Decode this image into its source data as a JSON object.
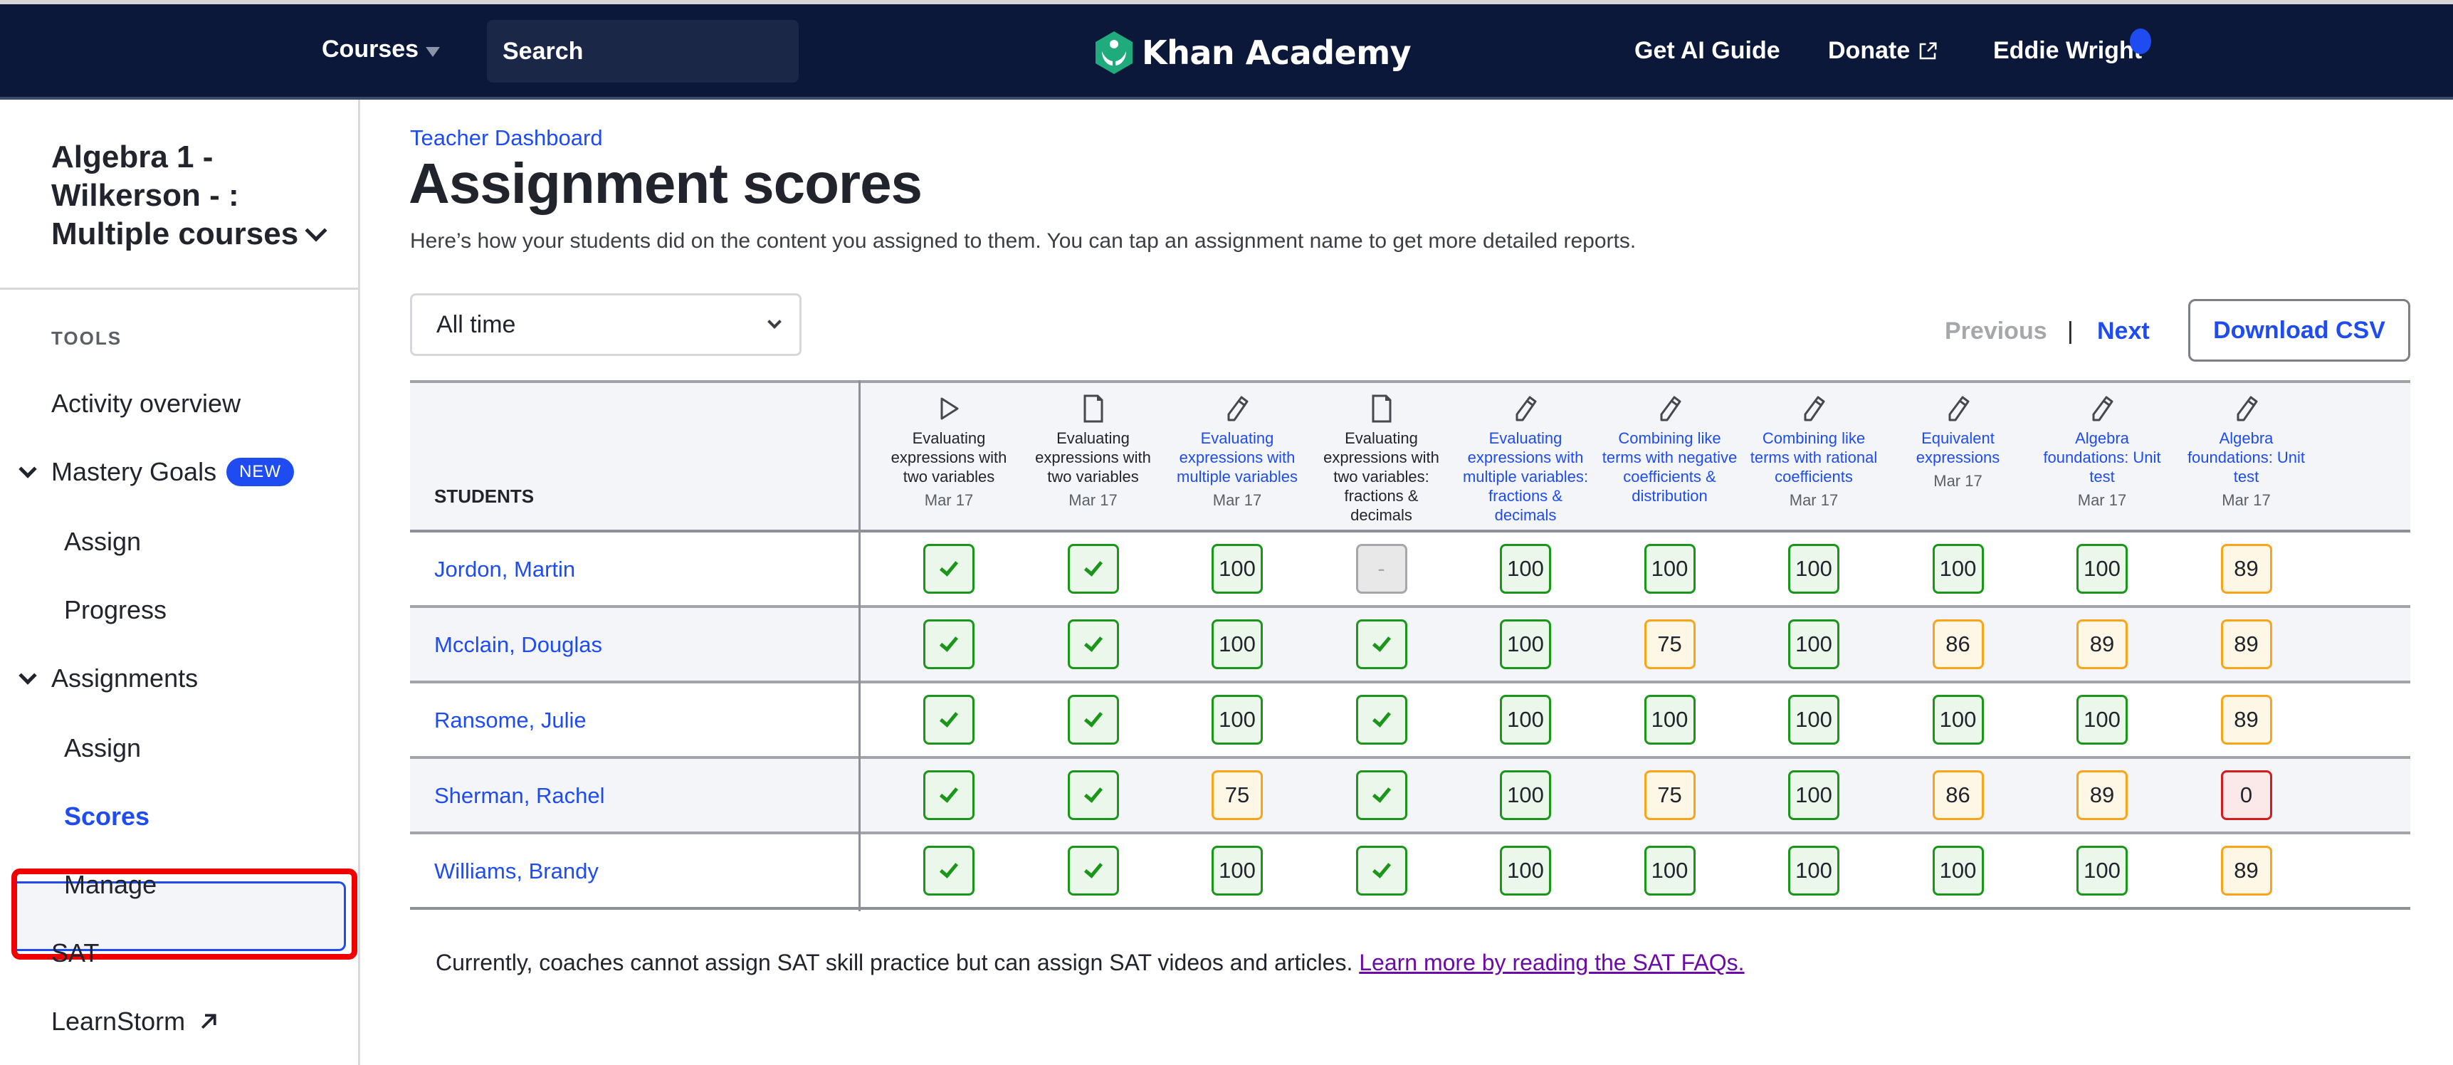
{
  "nav": {
    "courses_label": "Courses",
    "search_placeholder": "Search",
    "logo_text": "Khan Academy",
    "ai_guide_label": "Get AI Guide",
    "donate_label": "Donate",
    "user_name": "Eddie Wright"
  },
  "sidebar": {
    "course_title": "Algebra 1 - Wilkerson - : Multiple courses",
    "tools_label": "TOOLS",
    "activity_overview": "Activity overview",
    "mastery_goals": "Mastery Goals",
    "new_badge": "NEW",
    "mastery_assign": "Assign",
    "mastery_progress": "Progress",
    "assignments": "Assignments",
    "assignments_assign": "Assign",
    "assignments_scores": "Scores",
    "assignments_manage": "Manage",
    "sat": "SAT",
    "learnstorm": "LearnStorm"
  },
  "main": {
    "breadcrumb": "Teacher Dashboard",
    "title": "Assignment scores",
    "subtitle": "Here’s how your students did on the content you assigned to them. You can tap an assignment name to get more detailed reports.",
    "timeframe": "All time",
    "previous_label": "Previous",
    "separator": "|",
    "next_label": "Next",
    "download_csv": "Download CSV",
    "footnote_text": "Currently, coaches cannot assign SAT skill practice but can assign SAT videos and articles. ",
    "footnote_link": "Learn more by reading the SAT FAQs."
  },
  "table": {
    "students_header": "STUDENTS",
    "columns": [
      {
        "icon": "video-play-icon",
        "title": "Evaluating expressions with two variables",
        "date": "Mar 17",
        "link": false
      },
      {
        "icon": "article-icon",
        "title": "Evaluating expressions with two variables",
        "date": "Mar 17",
        "link": false
      },
      {
        "icon": "pencil-icon",
        "title": "Evaluating expressions with multiple variables",
        "date": "Mar 17",
        "link": true
      },
      {
        "icon": "article-icon",
        "title": "Evaluating expressions with two variables: fractions & decimals",
        "date": "",
        "link": false
      },
      {
        "icon": "pencil-icon",
        "title": "Evaluating expressions with multiple variables: fractions & decimals",
        "date": "",
        "link": true
      },
      {
        "icon": "pencil-icon",
        "title": "Combining like terms with negative coefficients & distribution",
        "date": "",
        "link": true
      },
      {
        "icon": "pencil-icon",
        "title": "Combining like terms with rational coefficients",
        "date": "Mar 17",
        "link": true
      },
      {
        "icon": "pencil-icon",
        "title": "Equivalent expressions",
        "date": "Mar 17",
        "link": true
      },
      {
        "icon": "pencil-icon",
        "title": "Algebra foundations: Unit test",
        "date": "Mar 17",
        "link": true
      },
      {
        "icon": "pencil-icon",
        "title": "Algebra foundations: Unit test",
        "date": "Mar 17",
        "link": true
      }
    ],
    "rows": [
      {
        "student": "Jordon, Martin",
        "scores": [
          "check",
          "check",
          "100",
          "-",
          "100",
          "100",
          "100",
          "100",
          "100",
          "89"
        ]
      },
      {
        "student": "Mcclain, Douglas",
        "scores": [
          "check",
          "check",
          "100",
          "check",
          "100",
          "75",
          "100",
          "86",
          "89",
          "89"
        ]
      },
      {
        "student": "Ransome, Julie",
        "scores": [
          "check",
          "check",
          "100",
          "check",
          "100",
          "100",
          "100",
          "100",
          "100",
          "89"
        ]
      },
      {
        "student": "Sherman, Rachel",
        "scores": [
          "check",
          "check",
          "75",
          "check",
          "100",
          "75",
          "100",
          "86",
          "89",
          "0"
        ]
      },
      {
        "student": "Williams, Brandy",
        "scores": [
          "check",
          "check",
          "100",
          "check",
          "100",
          "100",
          "100",
          "100",
          "100",
          "89"
        ]
      }
    ]
  },
  "colors": {
    "nav_bg": "#0b1839",
    "accent_blue": "#1e4cf0",
    "score_green": "#1b961b",
    "score_orange": "#f8a51b",
    "score_red": "#d41c1c",
    "highlight_red": "#f00000"
  }
}
